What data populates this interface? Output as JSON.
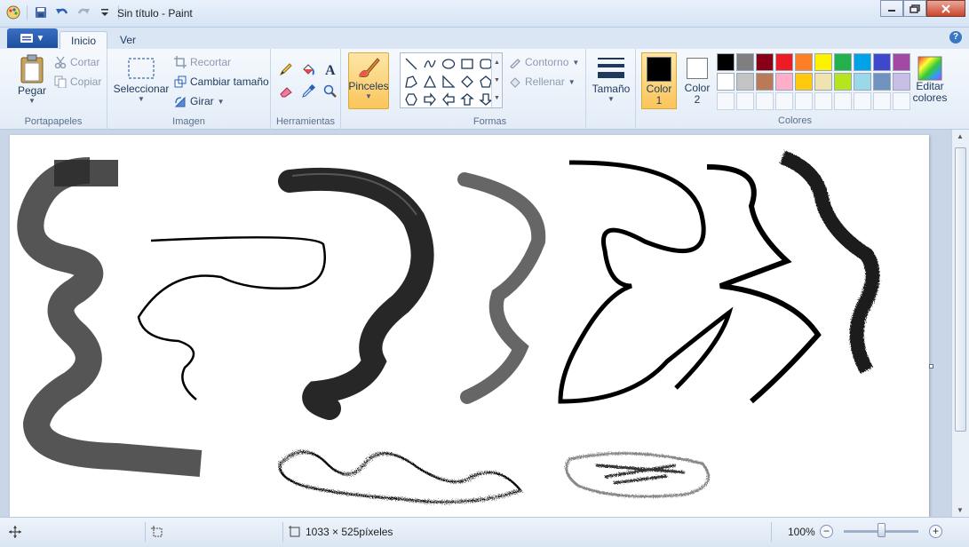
{
  "window": {
    "title": "Sin título - Paint",
    "controls": [
      "minimize-icon",
      "maximize-icon",
      "close-icon"
    ]
  },
  "quick_access": [
    "save-icon",
    "undo-icon",
    "redo-icon",
    "customize-icon"
  ],
  "tabs": [
    {
      "label": "Inicio",
      "active": true
    },
    {
      "label": "Ver",
      "active": false
    }
  ],
  "ribbon": {
    "portapapeles": {
      "label": "Portapapeles",
      "paste": "Pegar",
      "cut": "Cortar",
      "copy": "Copiar"
    },
    "imagen": {
      "label": "Imagen",
      "select": "Seleccionar",
      "crop": "Recortar",
      "resize": "Cambiar tamaño",
      "rotate": "Girar"
    },
    "herramientas": {
      "label": "Herramientas",
      "tools": [
        "pencil-icon",
        "fill-icon",
        "text-icon",
        "eraser-icon",
        "color-picker-icon",
        "magnifier-icon"
      ]
    },
    "brushes": {
      "label": "Pinceles"
    },
    "formas": {
      "label": "Formas",
      "outline": "Contorno",
      "fill": "Rellenar"
    },
    "size": {
      "label": "Tamaño"
    },
    "colores": {
      "label": "Colores",
      "color1_label": "Color",
      "color1_num": "1",
      "color1_value": "#000000",
      "color2_label": "Color",
      "color2_num": "2",
      "color2_value": "#ffffff",
      "edit_label_1": "Editar",
      "edit_label_2": "colores",
      "palette": [
        "#000000",
        "#7f7f7f",
        "#880015",
        "#ed1c24",
        "#ff7f27",
        "#fff200",
        "#22b14c",
        "#00a2e8",
        "#3f48cc",
        "#a349a4",
        "#ffffff",
        "#c3c3c3",
        "#b97a57",
        "#ffaec9",
        "#ffc90e",
        "#efe4b0",
        "#b5e61d",
        "#99d9ea",
        "#7092be",
        "#c8bfe7"
      ]
    }
  },
  "status": {
    "dimensions": "1033 × 525píxeles",
    "zoom": "100%",
    "zoom_fraction": 0.5
  }
}
